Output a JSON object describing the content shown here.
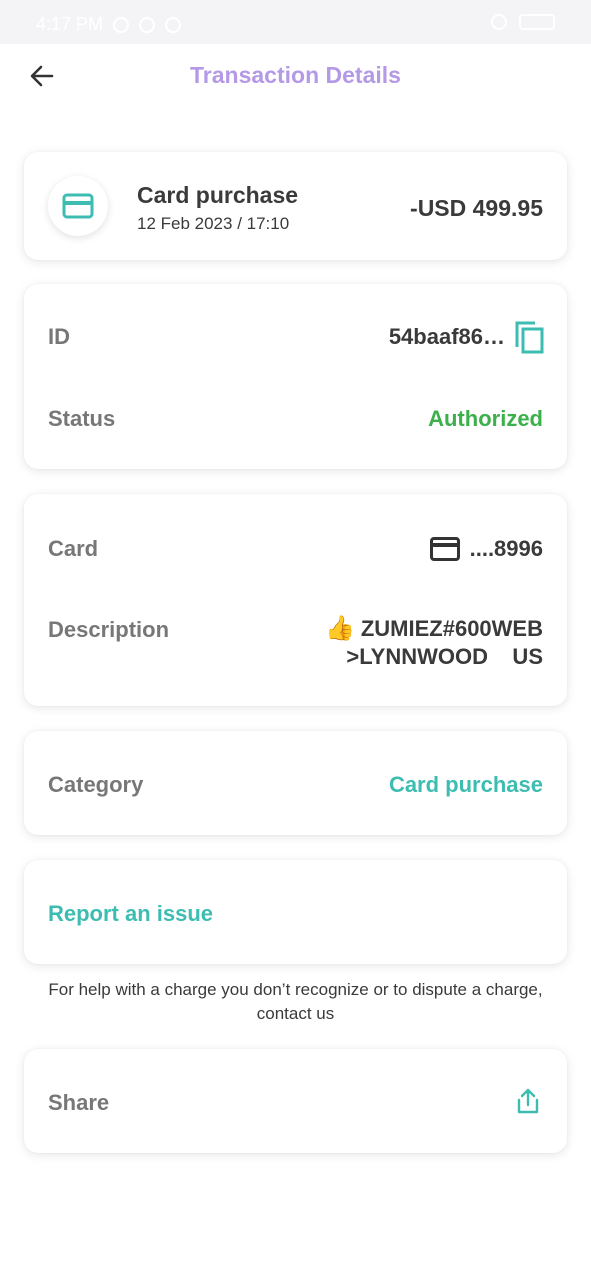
{
  "status_bar": {
    "time": "4:17 PM"
  },
  "header": {
    "title": "Transaction Details",
    "back_icon": "arrow-left-icon"
  },
  "summary": {
    "icon": "credit-card-icon",
    "title": "Card purchase",
    "date": "12 Feb 2023 / 17:10",
    "amount": "-USD 499.95"
  },
  "details": {
    "id_label": "ID",
    "id_value": "54baaf86…",
    "copy_icon": "copy-icon",
    "status_label": "Status",
    "status_value": "Authorized"
  },
  "card_info": {
    "card_label": "Card",
    "card_icon": "credit-card-icon",
    "card_value": "....8996",
    "description_label": "Description",
    "description_emoji": "👍",
    "description_line1": "ZUMIEZ#600WEB",
    "description_line2": ">LYNNWOOD    US"
  },
  "category": {
    "label": "Category",
    "value": "Card purchase"
  },
  "report": {
    "label": "Report an issue"
  },
  "help_text": "For help with a charge you don’t recognize or to dispute a charge, contact us",
  "share": {
    "label": "Share",
    "icon": "share-icon"
  },
  "colors": {
    "accent_teal": "#3dbdb2",
    "title_purple": "#b49ae6",
    "status_green": "#3cb04a",
    "text_dark": "#3a3a3a",
    "text_gray": "#777777"
  }
}
